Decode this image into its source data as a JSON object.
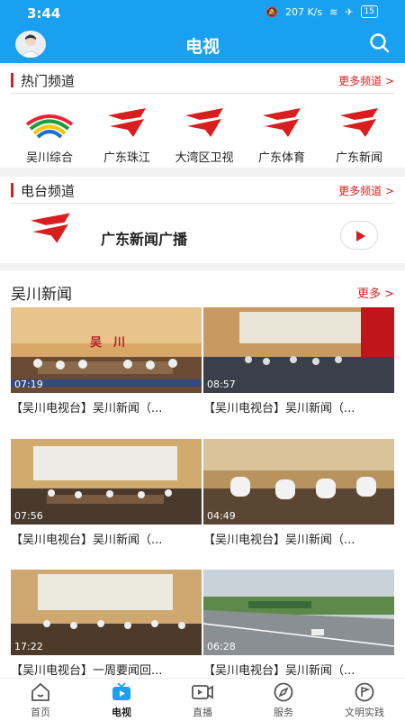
{
  "status_bar": {
    "time": "3:44",
    "network_speed": "207 K/s",
    "battery": "15"
  },
  "header": {
    "title": "电视"
  },
  "hot_channels": {
    "title": "热门频道",
    "more": "更多频道 >",
    "items": [
      {
        "name": "吴川综合",
        "icon": "wuchuan-logo"
      },
      {
        "name": "广东珠江",
        "icon": "gdtv-logo"
      },
      {
        "name": "大湾区卫视",
        "icon": "gdtv-logo"
      },
      {
        "name": "广东体育",
        "icon": "gdtv-logo"
      },
      {
        "name": "广东新闻",
        "icon": "gdtv-logo"
      }
    ]
  },
  "radio_channels": {
    "title": "电台频道",
    "more": "更多频道 >",
    "item": {
      "name": "广东新闻广播",
      "icon": "gdtv-logo"
    }
  },
  "wuchuan_news": {
    "title": "吴川新闻",
    "more": "更多 >",
    "videos": [
      {
        "duration": "07:19",
        "title": "【吴川电视台】吴川新闻（...",
        "thumb_text": "吴　川"
      },
      {
        "duration": "08:57",
        "title": "【吴川电视台】吴川新闻（..."
      },
      {
        "duration": "07:56",
        "title": "【吴川电视台】吴川新闻（..."
      },
      {
        "duration": "04:49",
        "title": "【吴川电视台】吴川新闻（..."
      },
      {
        "duration": "17:22",
        "title": "【吴川电视台】一周要闻回..."
      },
      {
        "duration": "06:28",
        "title": "【吴川电视台】吴川新闻（..."
      }
    ]
  },
  "bottom_nav": [
    {
      "label": "首页",
      "icon": "home-icon"
    },
    {
      "label": "电视",
      "icon": "tv-icon",
      "active": true
    },
    {
      "label": "直播",
      "icon": "live-icon"
    },
    {
      "label": "服务",
      "icon": "compass-icon"
    },
    {
      "label": "文明实践",
      "icon": "flag-icon"
    }
  ],
  "colors": {
    "header": "#1aa0f0",
    "accent": "#d81e1e"
  }
}
